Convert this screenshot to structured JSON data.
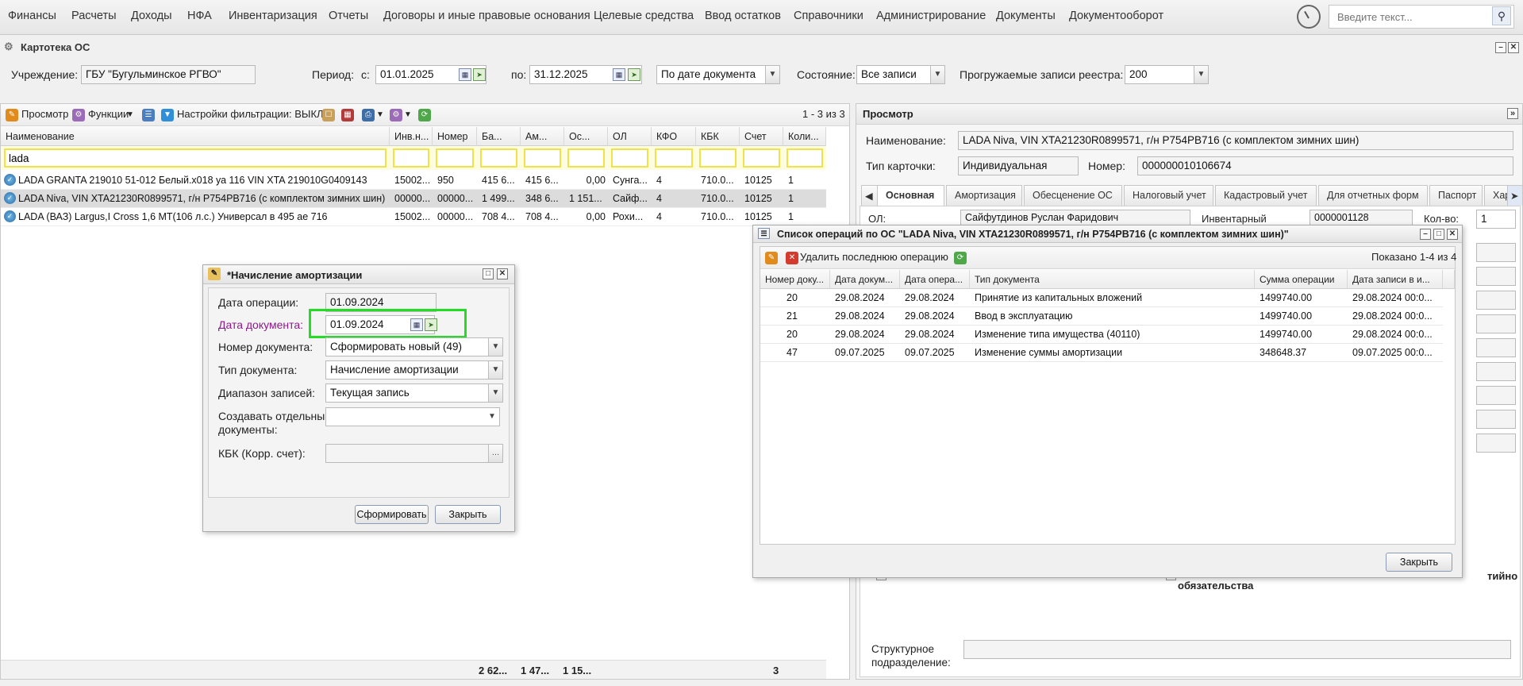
{
  "topmenu": {
    "items": [
      "Финансы",
      "Расчеты",
      "Доходы",
      "НФА",
      "Инвентаризация",
      "Отчеты",
      "Договоры и иные правовые основания",
      "Целевые средства",
      "Ввод остатков",
      "Справочники",
      "Администрирование",
      "Документы",
      "Документооборот"
    ],
    "search_placeholder": "Введите текст..."
  },
  "window": {
    "title": "Картотека ОС"
  },
  "filters": {
    "institution_label": "Учреждение:",
    "institution_value": "ГБУ \"Бугульминское РГВО\"",
    "period_label": "Период:",
    "from_label": "с:",
    "from_value": "01.01.2025",
    "to_label": "по:",
    "to_value": "31.12.2025",
    "date_mode": "По дате документа",
    "state_label": "Состояние:",
    "state_value": "Все записи",
    "loaded_label": "Прогружаемые записи реестра:",
    "loaded_value": "200"
  },
  "left_toolbar": {
    "view": "Просмотр",
    "functions": "Функции",
    "filter_settings": "Настройки фильтрации: ВЫКЛ",
    "count": "1 - 3 из 3"
  },
  "grid": {
    "columns": [
      "Наименование",
      "Инв.н...",
      "Номер",
      "Ба...",
      "Ам...",
      "Ос...",
      "ОЛ",
      "КФО",
      "КБК",
      "Счет",
      "Коли..."
    ],
    "name_filter": "lada",
    "rows": [
      [
        "LADA GRANTA 219010 51-012 Белый.х018 уа 116 VIN XTA 219010G0409143",
        "15002...",
        "950",
        "415 6...",
        "415 6...",
        "0,00",
        "Сунга...",
        "4",
        "710.0...",
        "10125",
        "1"
      ],
      [
        "LADA Niva, VIN XTA21230R0899571, г/н Р754РВ716 (с комплектом зимних шин)",
        "00000...",
        "00000...",
        "1 499...",
        "348 6...",
        "1 151...",
        "Сайф...",
        "4",
        "710.0...",
        "10125",
        "1"
      ],
      [
        "LADA (ВАЗ) Largus,I Cross 1,6 МТ(106 л.с.) Универсал в 495 ае 716",
        "15002...",
        "00000...",
        "708 4...",
        "708 4...",
        "0,00",
        "Рохи...",
        "4",
        "710.0...",
        "10125",
        "1"
      ]
    ],
    "totals": {
      "balance": "2 62...",
      "amort": "1 47...",
      "residual": "1 15...",
      "qty": "3"
    }
  },
  "right": {
    "title": "Просмотр",
    "name_label": "Наименование:",
    "name_value": "LADA Niva, VIN XTA21230R0899571, г/н Р754РВ716 (с комплектом зимних шин)",
    "card_type_label": "Тип карточки:",
    "card_type_value": "Индивидуальная",
    "number_label": "Номер:",
    "number_value": "000000010106674",
    "tabs": [
      "Основная",
      "Амортизация",
      "Обесценение ОС",
      "Налоговый учет",
      "Кадастровый учет",
      "Для отчетных форм",
      "Паспорт",
      "Хара"
    ],
    "partial_ol_label": "ОЛ:",
    "partial_ol_value": "Сайфутдинов Руслан Фаридович",
    "partial_inv_label": "Инвентарный",
    "partial_inv_value": "0000001128",
    "partial_qty_label": "Кол-во:",
    "partial_qty_value": "1",
    "obligations_text": "обязательства",
    "obligations_right": "тийно",
    "struct_label_1": "Структурное",
    "struct_label_2": "подразделение:"
  },
  "dlg_amort": {
    "title": "*Начисление амортизации",
    "op_date_label": "Дата операции:",
    "op_date_value": "01.09.2024",
    "doc_date_label": "Дата документа:",
    "doc_date_value": "01.09.2024",
    "doc_num_label": "Номер документа:",
    "doc_num_value": "Сформировать новый (49)",
    "doc_type_label": "Тип документа:",
    "doc_type_value": "Начисление амортизации",
    "range_label": "Диапазон записей:",
    "range_value": "Текущая запись",
    "separate_label_1": "Создавать отдельные",
    "separate_label_2": "документы:",
    "kbk_label": "КБК (Корр. счет):",
    "generate_btn": "Сформировать",
    "close_btn": "Закрыть"
  },
  "dlg_ops": {
    "title": "Список операций по ОС \"LADA Niva, VIN XTA21230R0899571, г/н Р754РВ716 (с комплектом зимних шин)\"",
    "delete_last": "Удалить последнюю операцию",
    "shown": "Показано 1-4 из 4",
    "columns": [
      "Номер доку...",
      "Дата докум...",
      "Дата опера...",
      "Тип документа",
      "Сумма операции",
      "Дата записи в и..."
    ],
    "rows": [
      [
        "20",
        "29.08.2024",
        "29.08.2024",
        "Принятие из капитальных вложений",
        "1499740.00",
        "29.08.2024 00:0..."
      ],
      [
        "21",
        "29.08.2024",
        "29.08.2024",
        "Ввод в эксплуатацию",
        "1499740.00",
        "29.08.2024 00:0..."
      ],
      [
        "20",
        "29.08.2024",
        "29.08.2024",
        "Изменение типа имущества (40110)",
        "1499740.00",
        "29.08.2024 00:0..."
      ],
      [
        "47",
        "09.07.2025",
        "09.07.2025",
        "Изменение суммы амортизации",
        "348648.37",
        "09.07.2025 00:0..."
      ]
    ],
    "close_btn": "Закрыть"
  },
  "colors": {
    "highlight": "#22dd22",
    "filter_yellow": "#f0e24a",
    "doc_date_label": "#8b1a8b"
  }
}
